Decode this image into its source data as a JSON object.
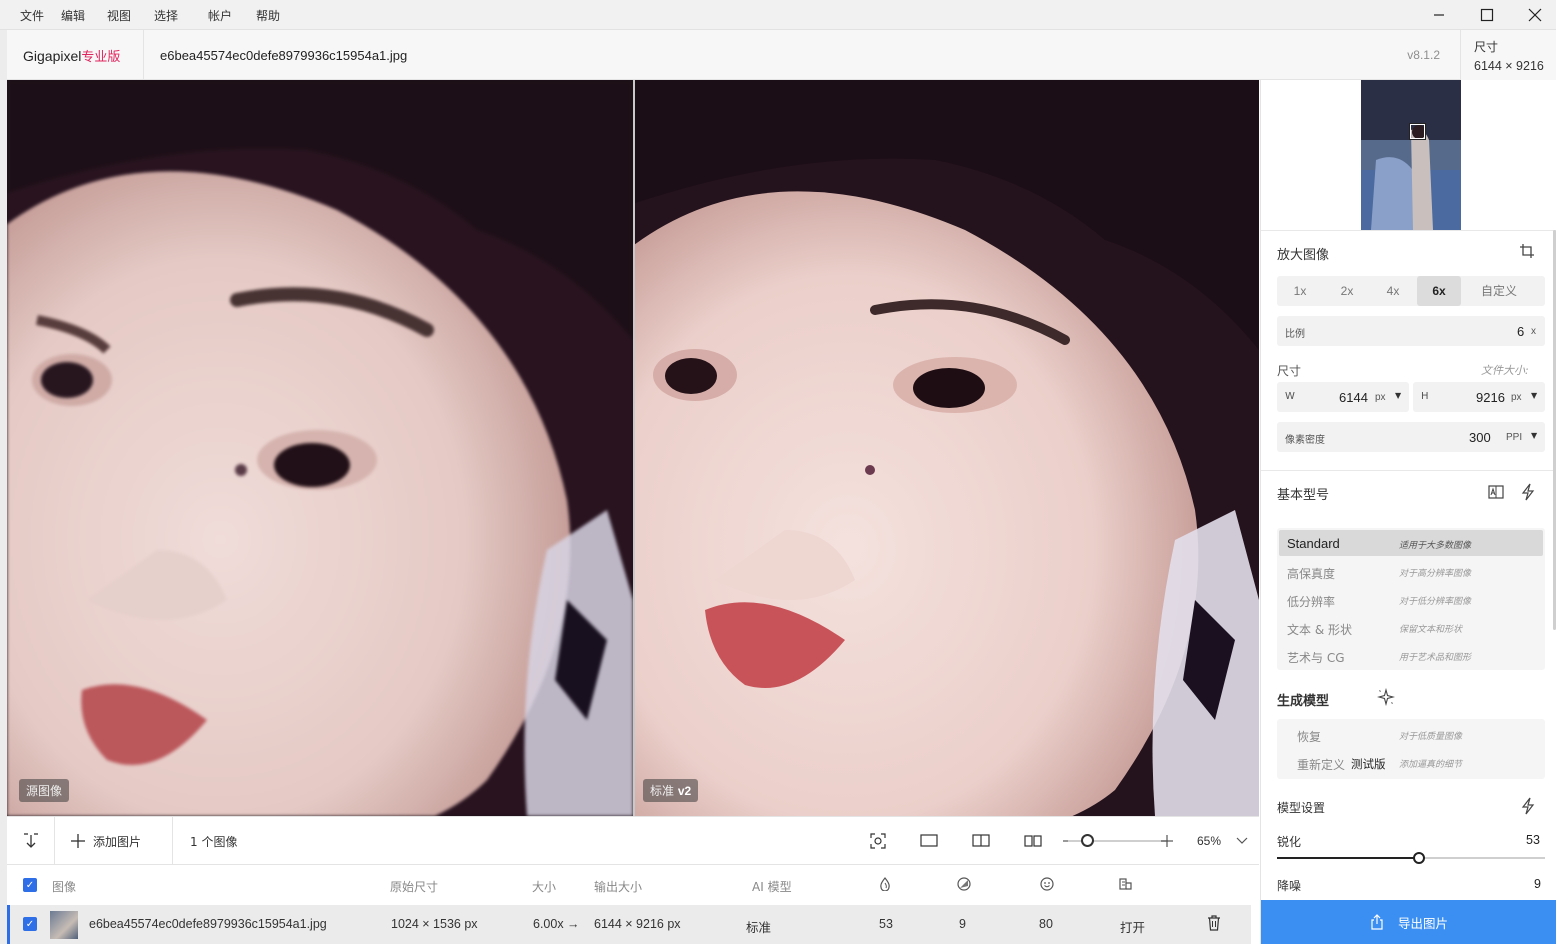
{
  "menu": [
    "文件",
    "编辑",
    "视图",
    "选择",
    "帐户",
    "帮助"
  ],
  "window_controls": [
    "minimize-icon",
    "maximize-icon",
    "close-icon"
  ],
  "header": {
    "brand": "Gigapixel",
    "brand_edition": "专业版",
    "filename": "e6bea45574ec0defe8979936c15954a1.jpg",
    "version": "v8.1.2"
  },
  "size_panel": {
    "label": "尺寸",
    "value": "6144 × 9216"
  },
  "viewer": {
    "left_tag": "源图像",
    "right_tag_prefix": "标准",
    "right_tag_version": "v2"
  },
  "toolbar": {
    "add_label": "添加图片",
    "count": "1 个图像",
    "zoom": "65%",
    "zoom_fraction": 0.2,
    "icons": [
      "import-icon",
      "add-icon",
      "fit-icon",
      "single-view-icon",
      "split-view-icon",
      "side-by-side-icon",
      "zoom-out-icon",
      "zoom-in-icon",
      "chevron-down-icon"
    ]
  },
  "table": {
    "headers": {
      "image": "图像",
      "orig_size": "原始尺寸",
      "scale": "大小",
      "out_size": "输出大小",
      "ai_model": "AI 模型"
    },
    "header_icons": [
      "sharpen-icon",
      "denoise-icon",
      "face-icon",
      "model-settings-icon"
    ],
    "row": {
      "filename": "e6bea45574ec0defe8979936c15954a1.jpg",
      "orig": "1024 × 1536 px",
      "scale": "6.00x →",
      "out": "6144 × 9216 px",
      "model": "标准",
      "sharpen": "53",
      "denoise": "9",
      "face": "80",
      "open": "打开"
    }
  },
  "sidebar": {
    "upscale": {
      "title": "放大图像",
      "options": [
        "1x",
        "2x",
        "4x",
        "6x",
        "自定义"
      ],
      "selected": "6x",
      "ratio_label": "比例",
      "ratio_value": "6",
      "ratio_unit": "x",
      "dim_label": "尺寸",
      "file_size_label": "文件大小:",
      "w_label": "W",
      "w_value": "6144",
      "w_unit": "px",
      "h_label": "H",
      "h_value": "9216",
      "h_unit": "px",
      "ppi_label": "像素密度",
      "ppi_value": "300",
      "ppi_unit": "PPI"
    },
    "base_models": {
      "title": "基本型号",
      "items": [
        {
          "name": "Standard",
          "desc": "适用于大多数图像"
        },
        {
          "name": "高保真度",
          "desc": "对于高分辨率图像"
        },
        {
          "name": "低分辨率",
          "desc": "对于低分辨率图像"
        },
        {
          "name": "文本 & 形状",
          "desc": "保留文本和形状"
        },
        {
          "name": "艺术与 CG",
          "desc": "用于艺术品和图形"
        }
      ]
    },
    "gen_models": {
      "title": "生成模型",
      "items": [
        {
          "name": "恢复",
          "desc": "对于低质量图像"
        },
        {
          "name": "重新定义",
          "badge": "测试版",
          "desc": "添加逼真的细节"
        }
      ]
    },
    "model_settings": {
      "title": "模型设置",
      "sharpen_label": "锐化",
      "sharpen_value": "53",
      "sharpen_fraction": 0.53,
      "denoise_label": "降噪",
      "denoise_value": "9"
    },
    "export_label": "导出图片"
  }
}
